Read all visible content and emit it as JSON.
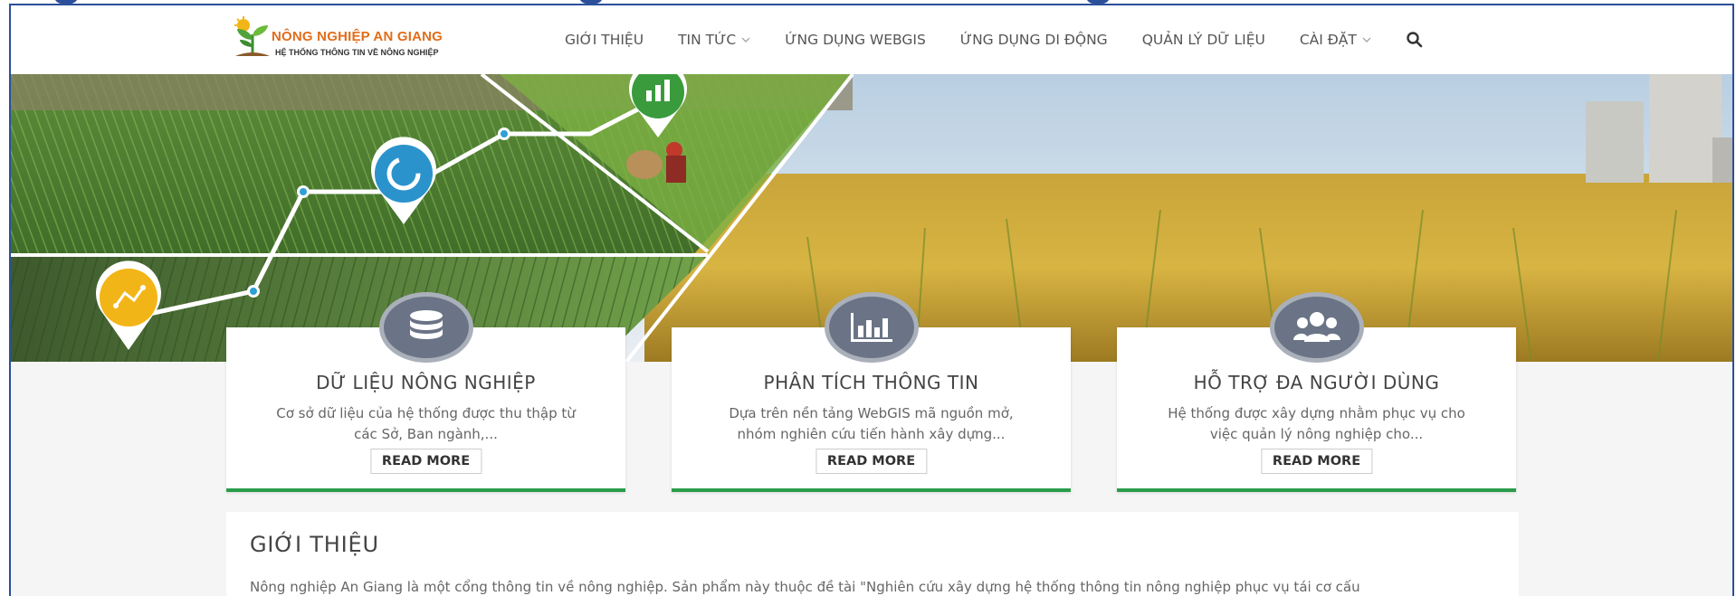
{
  "logo": {
    "title": "NÔNG NGHIỆP AN GIANG",
    "subtitle": "HỆ THỐNG THÔNG TIN VỀ NÔNG NGHIỆP"
  },
  "nav": {
    "items": [
      {
        "label": "GIỚI THIỆU",
        "has_dropdown": false
      },
      {
        "label": "TIN TỨC",
        "has_dropdown": true
      },
      {
        "label": "ỨNG DỤNG WEBGIS",
        "has_dropdown": false
      },
      {
        "label": "ỨNG DỤNG DI ĐỘNG",
        "has_dropdown": false
      },
      {
        "label": "QUẢN LÝ DỮ LIỆU",
        "has_dropdown": false
      },
      {
        "label": "CÀI ĐẶT",
        "has_dropdown": true
      }
    ],
    "search_icon": "search-icon"
  },
  "cards": [
    {
      "icon": "database-icon",
      "title": "DỮ LIỆU NÔNG NGHIỆP",
      "desc_line1": "Cơ sở dữ liệu của hệ thống được thu thập từ",
      "desc_line2": "các Sở, Ban ngành,...",
      "button": "READ MORE"
    },
    {
      "icon": "bar-chart-icon",
      "title": "PHÂN TÍCH THÔNG TIN",
      "desc_line1": "Dựa trên nền tảng WebGIS mã nguồn mở,",
      "desc_line2": "nhóm nghiên cứu tiến hành xây dựng...",
      "button": "READ MORE"
    },
    {
      "icon": "users-icon",
      "title": "HỖ TRỢ ĐA NGƯỜI DÙNG",
      "desc_line1": "Hệ thống được xây dựng nhằm phục vụ cho",
      "desc_line2": "việc quản lý nông nghiệp cho...",
      "button": "READ MORE"
    }
  ],
  "intro": {
    "title": "GIỚI THIỆU",
    "text": "Nông nghiệp An Giang là một cổng thông tin về nông nghiệp. Sản phẩm này thuộc đề tài \"Nghiên cứu xây dựng hệ thống thông tin nông nghiệp phục vụ tái cơ cấu"
  },
  "colors": {
    "accent_green": "#2a9d4b",
    "frame_blue": "#2b4f9a",
    "logo_orange": "#e26d1a",
    "icon_gray": "#6b7486"
  }
}
